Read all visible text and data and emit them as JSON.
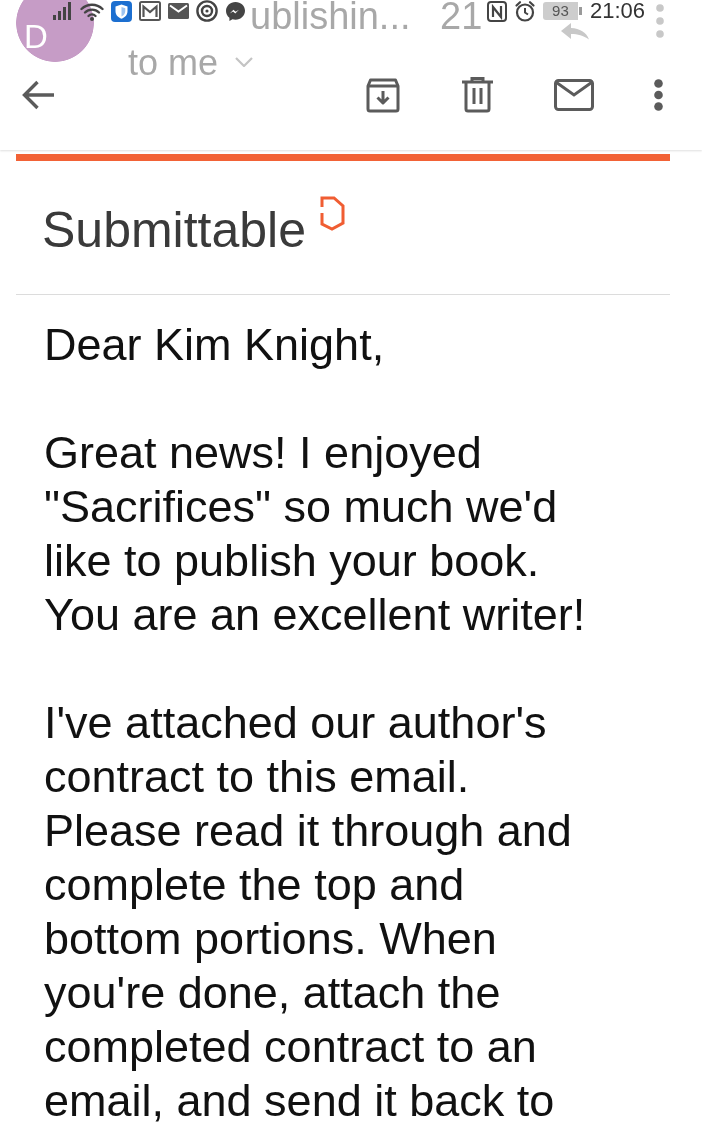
{
  "status_bar": {
    "battery": "93",
    "time": "21:06"
  },
  "faded_header": {
    "avatar_letter": "D",
    "sender": "ublishin...",
    "time": "21",
    "recipient": "to me"
  },
  "email": {
    "logo": "Submittable",
    "paragraphs": [
      "Dear Kim Knight,",
      "Great news! I enjoyed\n\"Sacrifices\" so much we'd\nlike to publish your book.\nYou are an excellent writer!",
      "I've attached our author's\ncontract to this email.\nPlease read it through and\ncomplete the top and\nbottom portions. When\nyou're done, attach the\ncompleted contract to an\nemail, and send it back to"
    ]
  }
}
